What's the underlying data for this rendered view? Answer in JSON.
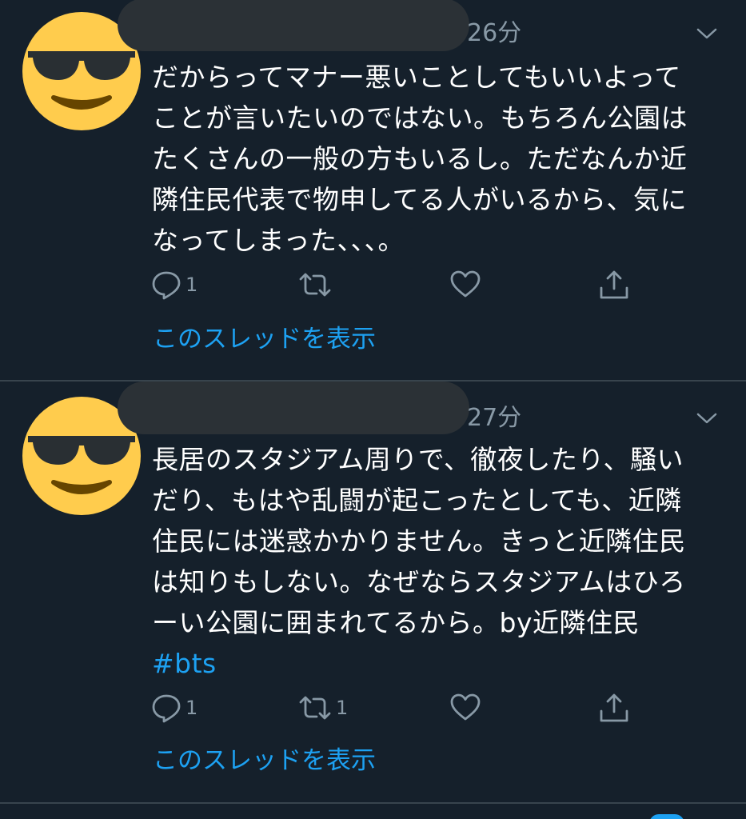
{
  "colors": {
    "background": "#15202b",
    "text": "#ffffff",
    "secondary_text": "#8899a6",
    "accent": "#1da1f2",
    "divider": "#38444d",
    "avatar_face": "#ffcc4d"
  },
  "tweets": [
    {
      "avatar_icon": "sunglasses-emoji",
      "time": "26分",
      "lines": [
        "だからってマナー悪いことしてもいいよって",
        "ことが言いたいのではない。もちろん公園は",
        "たくさんの一般の方もいるし。ただなんか近",
        "隣住民代表で物申してる人がいるから、気に",
        "なってしまった、、、。"
      ],
      "hashtag": "",
      "reply_count": "1",
      "retweet_count": "",
      "like_count": "",
      "thread_link": "このスレッドを表示"
    },
    {
      "avatar_icon": "sunglasses-emoji",
      "time": "27分",
      "lines": [
        "長居のスタジアム周りで、徹夜したり、騒い",
        "だり、もはや乱闘が起こったとしても、近隣",
        "住民には迷惑かかりません。きっと近隣住民",
        "は知りもしない。なぜならスタジアムはひろ",
        "ーい公園に囲まれてるから。by近隣住民"
      ],
      "hashtag": "#bts",
      "reply_count": "1",
      "retweet_count": "1",
      "like_count": "",
      "thread_link": "このスレッドを表示"
    }
  ]
}
